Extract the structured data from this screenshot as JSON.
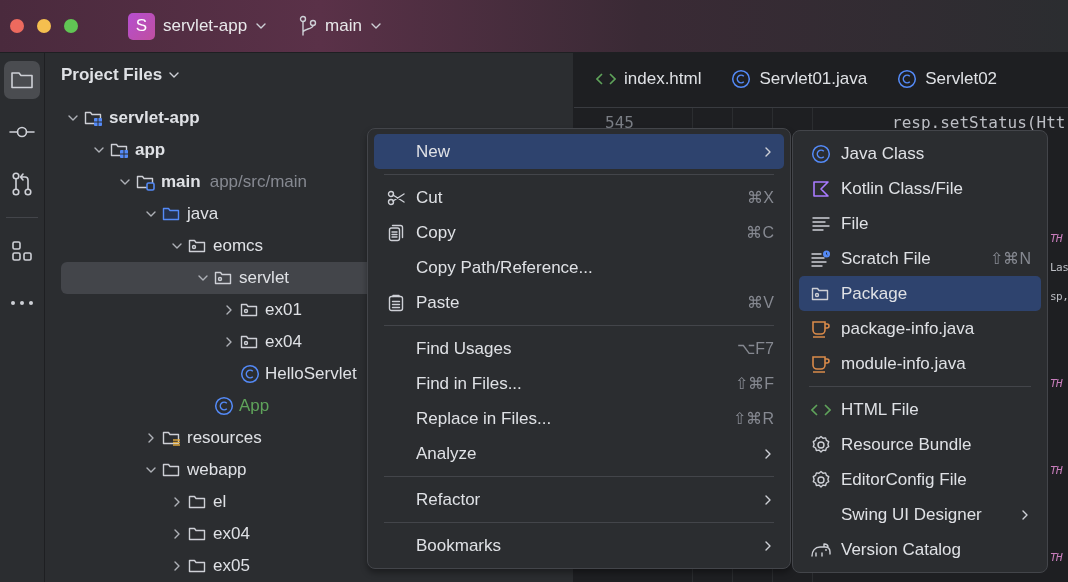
{
  "title_bar": {
    "project_badge": "S",
    "project": "servlet-app",
    "branch": "main"
  },
  "tool_strip": [
    {
      "kind": "project",
      "selected": true
    },
    {
      "kind": "commit",
      "selected": false
    },
    {
      "kind": "pull",
      "selected": false
    },
    {
      "kind": "structure",
      "selected": false
    },
    {
      "kind": "more",
      "selected": false
    }
  ],
  "project_panel": {
    "title": "Project Files",
    "tree": [
      {
        "label": "servlet-app",
        "kind": "module",
        "expanded": true,
        "selected": false,
        "children": [
          {
            "label": "app",
            "kind": "module",
            "expanded": true,
            "selected": false,
            "children": [
              {
                "label": "main",
                "hint": "app/src/main",
                "kind": "source-set",
                "expanded": true,
                "selected": false,
                "children": [
                  {
                    "label": "java",
                    "kind": "source-root",
                    "expanded": true,
                    "selected": false,
                    "children": [
                      {
                        "label": "eomcs",
                        "kind": "package",
                        "expanded": true,
                        "selected": false,
                        "children": [
                          {
                            "label": "servlet",
                            "kind": "package",
                            "expanded": true,
                            "selected": true,
                            "children": [
                              {
                                "label": "ex01",
                                "kind": "package",
                                "expanded": false,
                                "selected": false
                              },
                              {
                                "label": "ex04",
                                "kind": "package",
                                "expanded": false,
                                "selected": false
                              },
                              {
                                "label": "HelloServlet",
                                "kind": "class",
                                "added": false,
                                "selected": false
                              }
                            ]
                          },
                          {
                            "label": "App",
                            "kind": "class",
                            "added": true,
                            "selected": false
                          }
                        ]
                      }
                    ]
                  },
                  {
                    "label": "resources",
                    "kind": "resources",
                    "expanded": false,
                    "selected": false
                  },
                  {
                    "label": "webapp",
                    "kind": "folder",
                    "expanded": true,
                    "selected": false,
                    "children": [
                      {
                        "label": "el",
                        "kind": "folder",
                        "expanded": false,
                        "selected": false
                      },
                      {
                        "label": "ex04",
                        "kind": "folder",
                        "expanded": false,
                        "selected": false
                      },
                      {
                        "label": "ex05",
                        "kind": "folder",
                        "expanded": false,
                        "selected": false
                      }
                    ]
                  }
                ]
              }
            ]
          }
        ]
      }
    ]
  },
  "editor": {
    "tabs": [
      {
        "label": "index.html",
        "kind": "html",
        "selected": false
      },
      {
        "label": "Servlet01.java",
        "kind": "class",
        "selected": false
      },
      {
        "label": "Servlet02",
        "kind": "class",
        "selected": false
      }
    ],
    "lines": [
      {
        "number": "545",
        "text": "resp.setStatus(Htt",
        "kind": "plain"
      },
      {
        "text": "TH",
        "kind": "constant"
      },
      {
        "text": "Las",
        "kind": "plain"
      },
      {
        "text": "sp,",
        "kind": "plain"
      },
      {
        "text": "TH",
        "kind": "constant"
      },
      {
        "text": "TH",
        "kind": "constant"
      },
      {
        "text": "TH",
        "kind": "constant"
      }
    ]
  },
  "context_menu": {
    "groups": [
      [
        {
          "label": "New",
          "kind": "plain",
          "submenu": true,
          "selected": true
        }
      ],
      [
        {
          "label": "Cut",
          "kind": "cut",
          "shortcut": "⌘X",
          "selected": false
        },
        {
          "label": "Copy",
          "kind": "copy",
          "shortcut": "⌘C",
          "selected": false
        },
        {
          "label": "Copy Path/Reference...",
          "kind": "plain",
          "selected": false
        },
        {
          "label": "Paste",
          "kind": "paste",
          "shortcut": "⌘V",
          "selected": false
        }
      ],
      [
        {
          "label": "Find Usages",
          "kind": "plain",
          "shortcut": "⌥F7",
          "selected": false
        },
        {
          "label": "Find in Files...",
          "kind": "plain",
          "shortcut": "⇧⌘F",
          "selected": false
        },
        {
          "label": "Replace in Files...",
          "kind": "plain",
          "shortcut": "⇧⌘R",
          "selected": false
        },
        {
          "label": "Analyze",
          "kind": "plain",
          "submenu": true,
          "selected": false
        }
      ],
      [
        {
          "label": "Refactor",
          "kind": "plain",
          "submenu": true,
          "selected": false
        }
      ],
      [
        {
          "label": "Bookmarks",
          "kind": "plain",
          "submenu": true,
          "selected": false
        }
      ]
    ]
  },
  "new_submenu": {
    "groups": [
      [
        {
          "label": "Java Class",
          "kind": "class",
          "selected": false
        },
        {
          "label": "Kotlin Class/File",
          "kind": "kotlin",
          "selected": false
        },
        {
          "label": "File",
          "kind": "file",
          "selected": false
        },
        {
          "label": "Scratch File",
          "kind": "scratch",
          "shortcut": "⇧⌘N",
          "selected": false
        },
        {
          "label": "Package",
          "kind": "package",
          "selected": true
        },
        {
          "label": "package-info.java",
          "kind": "java-file",
          "selected": false
        },
        {
          "label": "module-info.java",
          "kind": "java-file",
          "selected": false
        }
      ],
      [
        {
          "label": "HTML File",
          "kind": "html",
          "selected": false
        },
        {
          "label": "Resource Bundle",
          "kind": "gear",
          "selected": false
        },
        {
          "label": "EditorConfig File",
          "kind": "gear",
          "selected": false
        },
        {
          "label": "Swing UI Designer",
          "kind": "plain",
          "submenu": true,
          "selected": false
        },
        {
          "label": "Version Catalog",
          "kind": "catalog",
          "selected": false
        }
      ]
    ]
  }
}
